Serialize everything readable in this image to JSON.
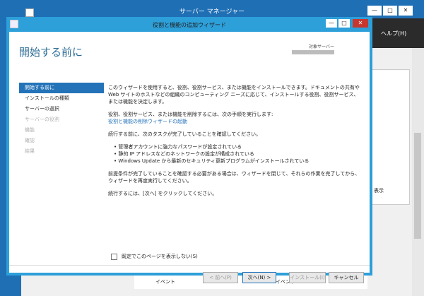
{
  "background": {
    "title": "サーバー マネージャー",
    "window_buttons": [
      "—",
      "□",
      "✕"
    ],
    "menu_label": "ヘルプ(H)",
    "panel_text": "表示",
    "bottom_labels": [
      "イベント",
      "イベント"
    ]
  },
  "wizard": {
    "title": "役割と機能の追加ウィザード",
    "window_buttons": [
      "—",
      "□",
      "✕"
    ],
    "page_title": "開始する前に",
    "target_label": "対象サーバー",
    "nav": [
      {
        "label": "開始する前に",
        "state": "active"
      },
      {
        "label": "インストールの種類",
        "state": "normal"
      },
      {
        "label": "サーバーの選択",
        "state": "normal"
      },
      {
        "label": "サーバーの役割",
        "state": "disabled"
      },
      {
        "label": "機能",
        "state": "disabled"
      },
      {
        "label": "確認",
        "state": "disabled"
      },
      {
        "label": "結果",
        "state": "disabled"
      }
    ],
    "content": {
      "p1": "このウィザードを使用すると、役割、役割サービス、または機能をインストールできます。ドキュメントの共有や Web サイトのホストなどの組織のコンピューティング ニーズに応じて、インストールする役割、役割サービス、または機能を決定します。",
      "p2": "役割、役割サービス、または機能を削除するには、次の手順を実行します:",
      "link": "役割と機能の削除ウィザードの起動",
      "p3": "続行する前に、次のタスクが完了していることを確認してください。",
      "bullets": [
        "管理者アカウントに強力なパスワードが設定されている",
        "静的 IP アドレスなどのネットワークの設定が構成されている",
        "Windows Update から最新のセキュリティ更新プログラムがインストールされている"
      ],
      "p4": "前提条件が完了していることを確認する必要がある場合は、ウィザードを閉じて、それらの作業を完了してから、ウィザードを再度実行してください。",
      "p5": "続行するには、[次へ] をクリックしてください。"
    },
    "checkbox_label": "既定でこのページを表示しない(S)",
    "buttons": {
      "prev": "< 前へ(P)",
      "next": "次へ(N) >",
      "install": "インストール(I)",
      "cancel": "キャンセル"
    }
  }
}
